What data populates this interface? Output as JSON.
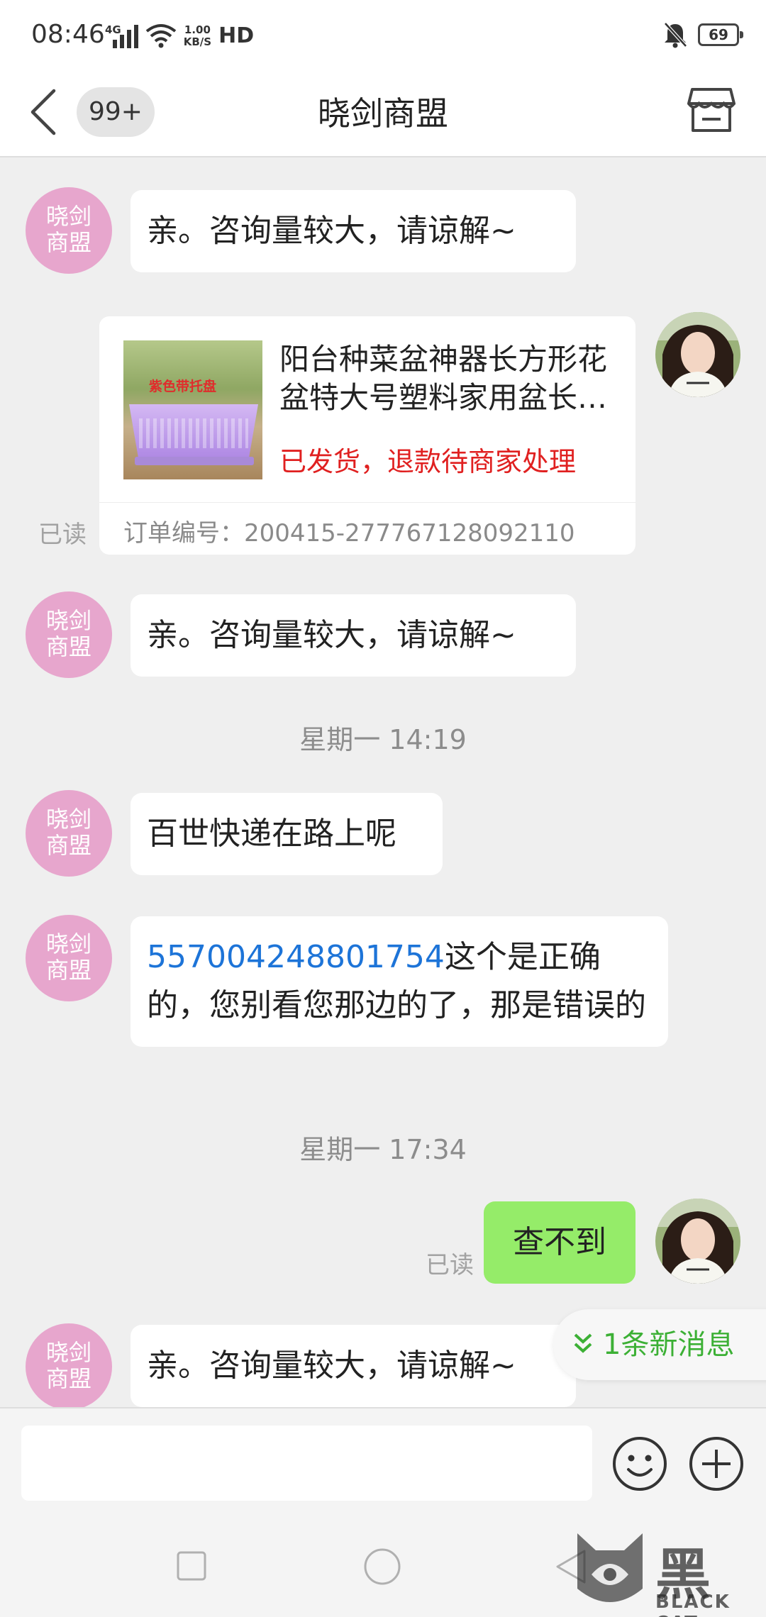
{
  "status_bar": {
    "time": "08:46",
    "network": "4G",
    "speed_value": "1.00",
    "speed_unit": "KB/S",
    "hd": "HD",
    "battery": "69"
  },
  "header": {
    "unread_count": "99+",
    "title": "晓剑商盟"
  },
  "shop_avatar_text": "晓剑\n商盟",
  "messages": {
    "m1": "亲。咨询量较大，请谅解~",
    "m2": "亲。咨询量较大，请谅解~",
    "m3": "百世快递在路上呢",
    "m4_link": "557004248801754",
    "m4_rest": "这个是正确的，您别看您那边的了，那是错误的",
    "m5": "查不到",
    "m6": "亲。咨询量较大，请谅解~"
  },
  "order_card": {
    "image_tag": "紫色带托盘",
    "product_title": "阳台种菜盆神器长方形花盆特大号塑料家用盆长条蔬菜种植箱",
    "status": "已发货，退款待商家处理",
    "order_number": "订单编号：200415-277767128092110"
  },
  "read_label": "已读",
  "time_separators": {
    "t1": "星期一 14:19",
    "t2": "星期一 17:34"
  },
  "new_message_pill": "1条新消息",
  "watermark": {
    "main": "黑猫",
    "sub": "BLACK CAT"
  },
  "colors": {
    "shop_avatar": "#e7a6cd",
    "my_bubble": "#95ec69",
    "link": "#1d74d8",
    "refund_status": "#e02020",
    "new_message": "#3cb035"
  },
  "icons": [
    "back-icon",
    "store-icon",
    "emoji-icon",
    "plus-icon",
    "bell-muted-icon",
    "wifi-icon",
    "signal-icon"
  ]
}
